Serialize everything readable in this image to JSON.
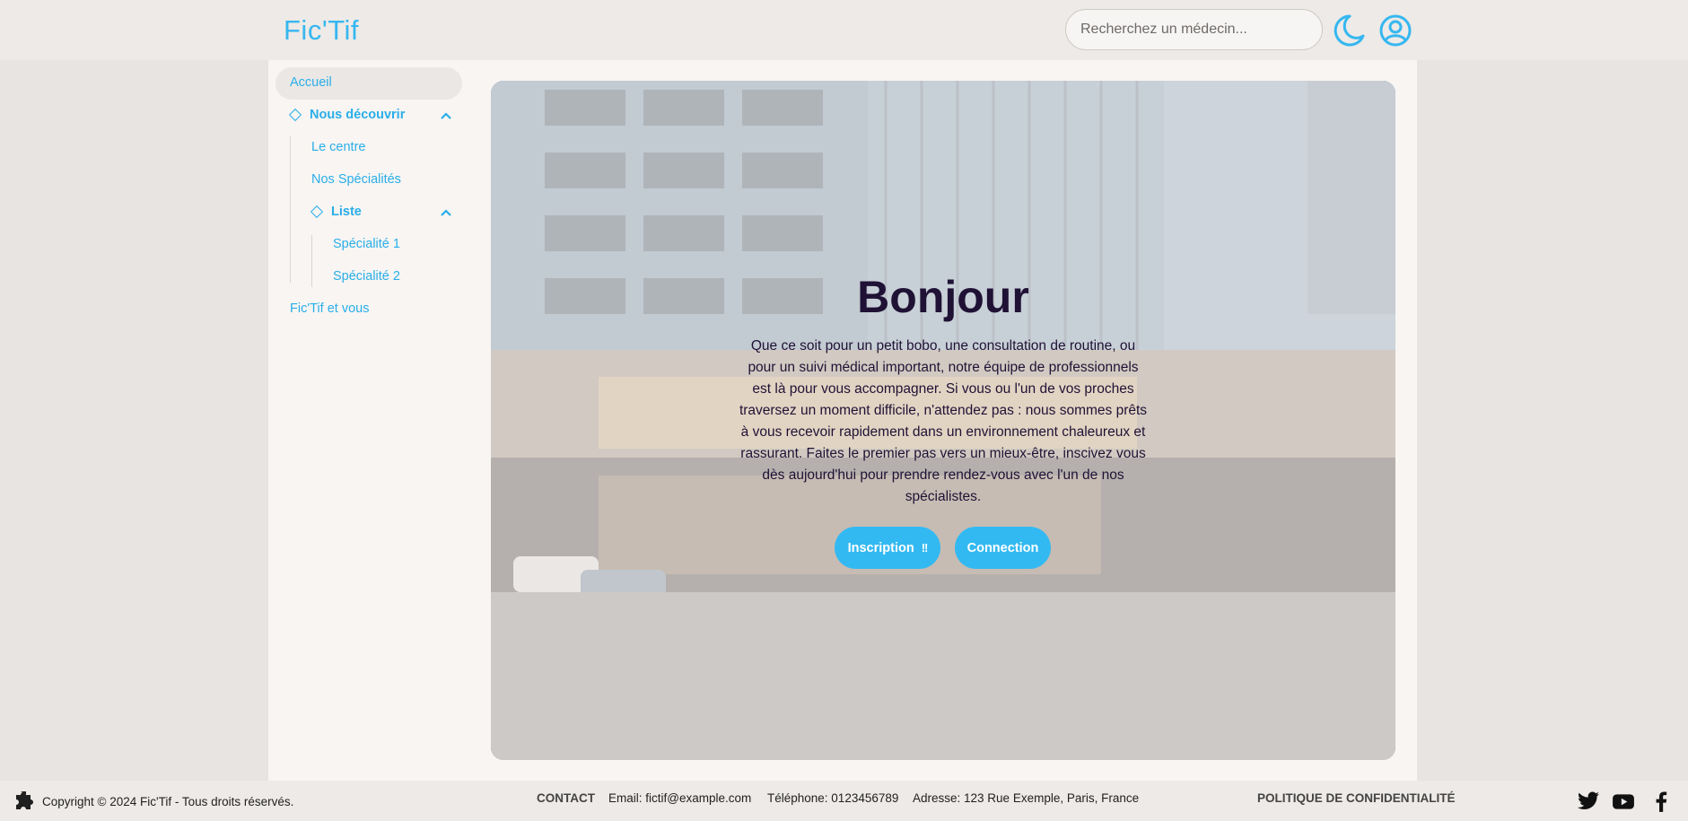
{
  "header": {
    "logo": "Fic'Tif",
    "search_placeholder": "Recherchez un médecin...",
    "icons": [
      "moon-icon",
      "user-icon"
    ]
  },
  "sidebar": {
    "items": [
      {
        "label": "Accueil",
        "active": true
      },
      {
        "label": "Nous découvrir",
        "expanded": true
      },
      {
        "label": "Le centre"
      },
      {
        "label": "Nos Spécialités"
      },
      {
        "label": "Liste",
        "expanded": true
      },
      {
        "label": "Spécialité 1"
      },
      {
        "label": "Spécialité 2"
      },
      {
        "label": "Fic'Tif et vous"
      }
    ]
  },
  "hero": {
    "title": "Bonjour",
    "text": "Que ce soit pour un petit bobo, une consultation de routine, ou pour un suivi médical important, notre équipe de professionnels est là pour vous accompagner. Si vous ou l'un de vos proches traversez un moment difficile, n'attendez pas : nous sommes prêts à vous recevoir rapidement dans un environnement chaleureux et rassurant. Faites le premier pas vers un mieux-être, inscivez vous dès aujourd'hui pour prendre rendez-vous avec l'un de nos spécialistes.",
    "buttons": {
      "inscription": "Inscription",
      "inscription_badge": "!!",
      "connection": "Connection"
    }
  },
  "footer": {
    "copyright": "Copyright © 2024 Fic'Tif - Tous droits réservés.",
    "contact": "CONTACT",
    "email": "Email: fictif@example.com",
    "phone": "Téléphone: 0123456789",
    "address": "Adresse: 123 Rue Exemple, Paris, France",
    "privacy": "POLITIQUE DE CONFIDENTIALITÉ",
    "social": [
      "twitter-icon",
      "youtube-icon",
      "facebook-icon"
    ]
  },
  "colors": {
    "accent": "#36b7f0",
    "title": "#1f1235",
    "bg": "#e8e4e1"
  }
}
